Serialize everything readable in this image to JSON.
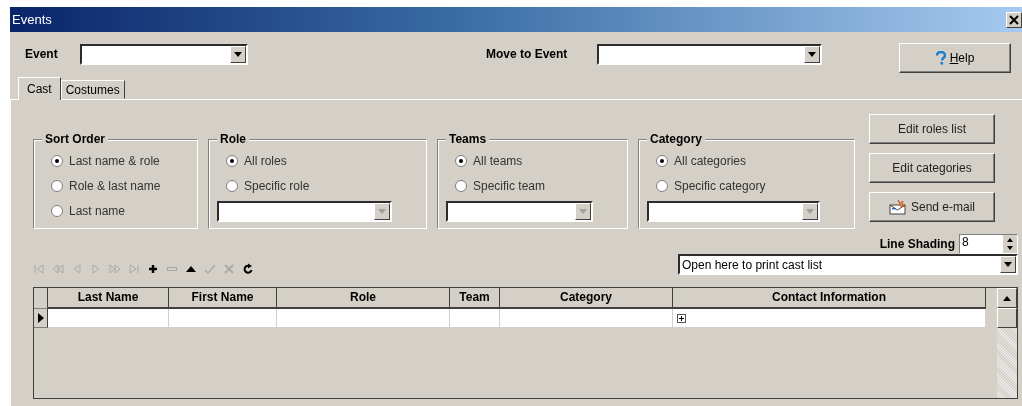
{
  "window": {
    "title": "Events"
  },
  "event_field": {
    "label": "Event"
  },
  "move_field": {
    "label": "Move to Event"
  },
  "help_button": {
    "label": "Help"
  },
  "tabs": [
    {
      "label": "Cast",
      "selected": true
    },
    {
      "label": "Costumes",
      "selected": false
    }
  ],
  "groups": [
    {
      "title": "Sort Order",
      "options": [
        {
          "label": "Last name & role",
          "selected": true
        },
        {
          "label": "Role & last name",
          "selected": false
        },
        {
          "label": "Last name",
          "selected": false
        }
      ]
    },
    {
      "title": "Role",
      "options": [
        {
          "label": "All roles",
          "selected": true
        },
        {
          "label": "Specific role",
          "selected": false
        }
      ],
      "dropdown": {
        "disabled": true
      }
    },
    {
      "title": "Teams",
      "options": [
        {
          "label": "All teams",
          "selected": true
        },
        {
          "label": "Specific team",
          "selected": false
        }
      ],
      "dropdown": {
        "disabled": true
      }
    },
    {
      "title": "Category",
      "options": [
        {
          "label": "All categories",
          "selected": true
        },
        {
          "label": "Specific category",
          "selected": false
        }
      ],
      "dropdown": {
        "disabled": true
      }
    }
  ],
  "side_buttons": [
    {
      "label": "Edit roles list",
      "kind": "plain"
    },
    {
      "label": "Edit categories",
      "kind": "plain"
    },
    {
      "label": "Send e-mail",
      "kind": "email"
    }
  ],
  "line_shading": {
    "label": "Line Shading",
    "value": "8"
  },
  "toolbar": [
    {
      "kind": "first",
      "disabled": true
    },
    {
      "kind": "prior-page",
      "disabled": true
    },
    {
      "kind": "prior",
      "disabled": true
    },
    {
      "kind": "next",
      "disabled": true
    },
    {
      "kind": "next-page",
      "disabled": true
    },
    {
      "kind": "last",
      "disabled": true
    },
    {
      "kind": "insert",
      "disabled": false
    },
    {
      "kind": "delete",
      "disabled": true
    },
    {
      "kind": "edit",
      "disabled": false
    },
    {
      "kind": "post",
      "disabled": true
    },
    {
      "kind": "cancel",
      "disabled": true
    },
    {
      "kind": "refresh",
      "disabled": false
    }
  ],
  "print_dropdown": {
    "value": "Open here to print cast list"
  },
  "table": {
    "columns": [
      "Last Name",
      "First Name",
      "Role",
      "Team",
      "Category",
      "Contact Information"
    ],
    "rows": [
      {
        "current": true,
        "expandable": true
      }
    ]
  }
}
